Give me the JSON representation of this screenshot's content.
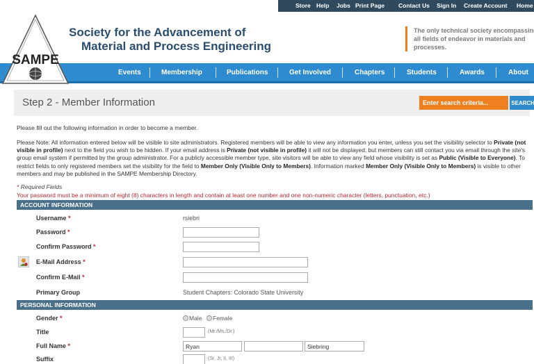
{
  "topnav": {
    "items": [
      "Store",
      "Help",
      "Jobs",
      "Print Page",
      "Contact Us",
      "Sign In",
      "Create Account",
      "Home"
    ]
  },
  "header": {
    "org_line1": "Society for the Advancement of",
    "org_line2": "Material and Process Engineering",
    "logo_text": "SAMPE",
    "tagline": [
      "The only technical society encompassing",
      "all fields of endeavor in materials and",
      "processes."
    ]
  },
  "mainnav": {
    "items": [
      "Events",
      "Membership",
      "Publications",
      "Get Involved",
      "Chapters",
      "Students",
      "Awards",
      "About"
    ]
  },
  "page": {
    "title": "Step 2 - Member Information",
    "search_placeholder": "Enter search criteria...",
    "search_button": "SEARCH »"
  },
  "intro": "Please fill out the following information in order to become a member.",
  "note": {
    "p1": "Please Note: All information entered below will be visible to site administrators. Registered members will be able to view any information you enter, unless you set the visibility selector to ",
    "b1": "Private (not visible in profile)",
    "p2": " next to the field you wish to be hidden. If your email address is ",
    "b2": "Private (not visible in profile)",
    "p3": " it will not be displayed, but members can still contact you via email through the site's group email system if permitted by the group administrator. For a publicly accessible member type, site visitors will be able to view any field whose visibility is set as ",
    "b3": "Public (Visible to Everyone)",
    "p4": ". To restrict fields to only registered members set the visibility for the field to ",
    "b4": "Member Only (Visible Only to Members)",
    "p5": ". Information marked ",
    "b5": "Member Only (Visible Only to Members)",
    "p6": " is visible to other members and may be published in the SAMPE Membership Directory."
  },
  "required_note": "Required Fields",
  "required_star": "*",
  "password_note": "Your password must be a minimum of eight (8) characters in length and contain at least one number and one non-numeric character (letters, punctuation, etc.)",
  "account": {
    "header": "ACCOUNT INFORMATION",
    "username_label": "Username",
    "username_value": "rsiebri",
    "password_label": "Password",
    "confirm_password_label": "Confirm Password",
    "email_label": "E-Mail Address",
    "confirm_email_label": "Confirm E-Mail",
    "primary_group_label": "Primary Group",
    "primary_group_value": "Student Chapters: Colorado State University"
  },
  "personal": {
    "header": "PERSONAL INFORMATION",
    "gender_label": "Gender",
    "gender_options": [
      "Male",
      "Female"
    ],
    "title_label": "Title",
    "title_hint": "(Mr./Ms./Dr.)",
    "fullname_label": "Full Name",
    "first_name": "Ryan",
    "middle_name": "",
    "last_name": "Siebring",
    "suffix_label": "Suffix",
    "suffix_hint": "(Sr, Jr, II, III)"
  },
  "colors": {
    "topbar": "#2f4a5f",
    "nav": "#2e8bd0",
    "accent_orange": "#f07a1c",
    "section_header": "#4a6f8a",
    "required_red": "#c0282d",
    "brand_text": "#2b4d6e"
  }
}
